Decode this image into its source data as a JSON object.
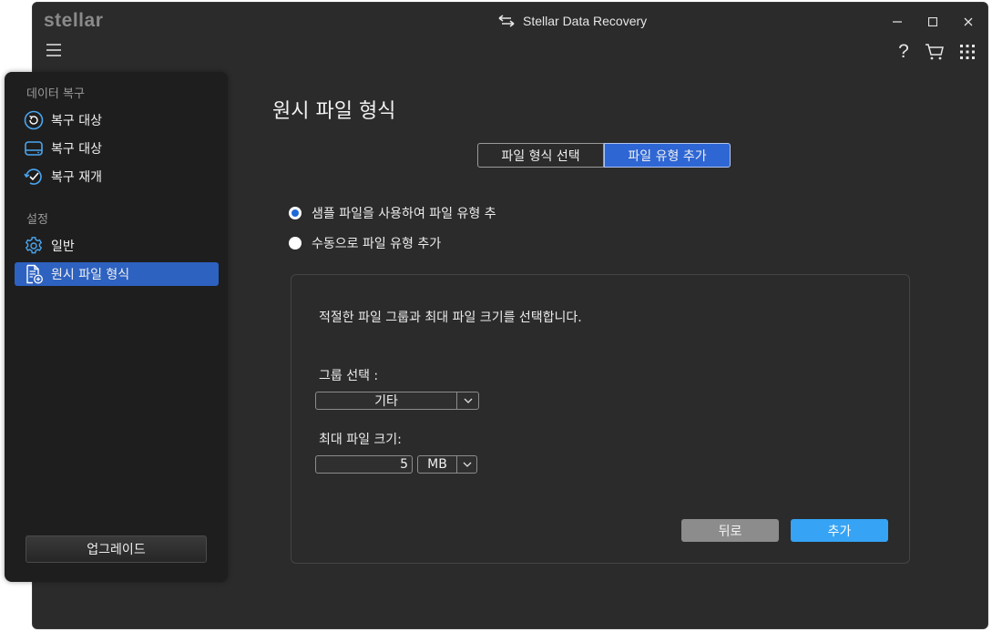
{
  "window": {
    "logo": "stellar",
    "title": "Stellar Data Recovery",
    "minimize": "–",
    "maximize": "☐",
    "close": "✕",
    "help": "?"
  },
  "sidebar": {
    "section1": "데이터 복구",
    "items1": [
      {
        "label": "복구 대상",
        "icon": "restore-icon"
      },
      {
        "label": "복구 대상",
        "icon": "drive-icon"
      },
      {
        "label": "복구 재개",
        "icon": "resume-check-icon"
      }
    ],
    "section2": "설정",
    "items2": [
      {
        "label": "일반",
        "icon": "gear-icon"
      },
      {
        "label": "원시 파일 형식",
        "icon": "file-add-icon",
        "active": true
      }
    ],
    "upgrade": "업그레이드"
  },
  "main": {
    "title": "원시 파일 형식",
    "tabs": [
      {
        "label": "파일 형식 선택",
        "active": false
      },
      {
        "label": "파일 유형 추가",
        "active": true
      }
    ],
    "radios": [
      {
        "label": "샘플 파일을 사용하여 파일 유형 추",
        "checked": true
      },
      {
        "label": "수동으로 파일 유형 추가",
        "checked": false
      }
    ],
    "panel": {
      "instruction": "적절한 파일 그룹과 최대 파일 크기를 선택합니다.",
      "group_label": "그룹 선택 :",
      "group_value": "기타",
      "size_label": "최대 파일 크기:",
      "size_value": "5",
      "unit_value": "MB",
      "back": "뒤로",
      "add": "추가"
    }
  },
  "colors": {
    "accent": "#2e62c1",
    "add_button": "#36a3f4",
    "back_button": "#8c8c8c",
    "background": "#2b2b2b"
  }
}
